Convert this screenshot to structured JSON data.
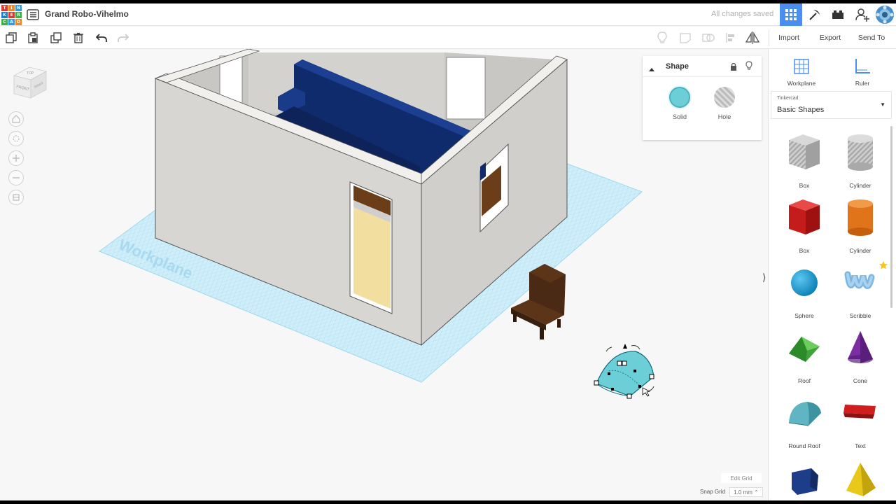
{
  "app": {
    "logo_letters": [
      "T",
      "I",
      "N",
      "K",
      "E",
      "R",
      "C",
      "A",
      "D"
    ],
    "document_title": "Grand Robo-Vihelmo",
    "save_status": "All changes saved"
  },
  "header_icons": [
    "grid-view-icon",
    "pickaxe-icon",
    "brick-icon",
    "add-user-icon",
    "avatar"
  ],
  "toolbar": {
    "left_tools": [
      "copy-icon",
      "paste-icon",
      "duplicate-icon",
      "delete-icon",
      "undo-icon",
      "redo-icon"
    ],
    "right_tools": [
      "light-bulb-icon",
      "note-icon",
      "shape-group-icon",
      "align-icon",
      "mirror-icon"
    ],
    "import_label": "Import",
    "export_label": "Export",
    "send_to_label": "Send To"
  },
  "viewport": {
    "workplane_label": "Workplane",
    "viewcube": {
      "top": "TOP",
      "front": "FRONT",
      "right": "RIGHT"
    },
    "nav_buttons": [
      "home-view-icon",
      "fit-view-icon",
      "zoom-in-icon",
      "zoom-out-icon",
      "perspective-icon"
    ],
    "edit_grid_label": "Edit Grid",
    "snap_grid_label": "Snap Grid",
    "snap_grid_value": "1.0 mm ⌃"
  },
  "shape_inspector": {
    "title": "Shape",
    "solid_label": "Solid",
    "hole_label": "Hole",
    "solid_color": "#6ccfd8"
  },
  "right_panel": {
    "workplane_label": "Workplane",
    "ruler_label": "Ruler",
    "library_source": "Tinkercad",
    "library_name": "Basic Shapes",
    "shapes": [
      {
        "label": "Box"
      },
      {
        "label": "Cylinder"
      },
      {
        "label": "Box"
      },
      {
        "label": "Cylinder"
      },
      {
        "label": "Sphere"
      },
      {
        "label": "Scribble"
      },
      {
        "label": "Roof"
      },
      {
        "label": "Cone"
      },
      {
        "label": "Round Roof"
      },
      {
        "label": "Text"
      }
    ]
  },
  "colors": {
    "accent": "#4a8ff0",
    "workplane_grid": "#a8dcef",
    "walls": "#d7d6d2",
    "furniture_blue": "#122e6e",
    "chair": "#4a2a14",
    "door": "#f2dfa0"
  }
}
